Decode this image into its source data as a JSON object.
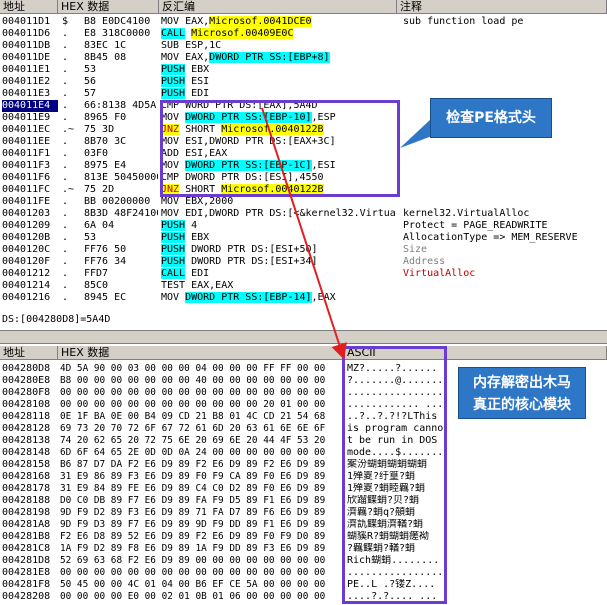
{
  "disasm": {
    "headers": {
      "addr": "地址",
      "hex": "HEX 数据",
      "asm": "反汇编",
      "comment": "注释"
    },
    "rows": [
      {
        "addr": "004011D1",
        "mark": "$",
        "hex": "B8 E0DC4100",
        "asm": "MOV EAX,Microsof.0041DCE0",
        "comment": "sub function load pe"
      },
      {
        "addr": "004011D6",
        "mark": ".",
        "hex": "E8 318C0000",
        "asm": "CALL Microsof.00409E0C",
        "comment": ""
      },
      {
        "addr": "004011DB",
        "mark": ".",
        "hex": "83EC 1C",
        "asm": "SUB ESP,1C",
        "comment": ""
      },
      {
        "addr": "004011DE",
        "mark": ".",
        "hex": "8B45 08",
        "asm": "MOV EAX,DWORD PTR SS:[EBP+8]",
        "comment": ""
      },
      {
        "addr": "004011E1",
        "mark": ".",
        "hex": "53",
        "asm": "PUSH EBX",
        "comment": ""
      },
      {
        "addr": "004011E2",
        "mark": ".",
        "hex": "56",
        "asm": "PUSH ESI",
        "comment": ""
      },
      {
        "addr": "004011E3",
        "mark": ".",
        "hex": "57",
        "asm": "PUSH EDI",
        "comment": ""
      },
      {
        "addr": "004011E4",
        "mark": ".",
        "hex": "66:8138 4D5A",
        "asm": "CMP WORD PTR DS:[EAX],5A4D",
        "comment": ""
      },
      {
        "addr": "004011E9",
        "mark": ".",
        "hex": "8965 F0",
        "asm": "MOV DWORD PTR SS:[EBP-10],ESP",
        "comment": ""
      },
      {
        "addr": "004011EC",
        "mark": ".~",
        "hex": "75 3D",
        "asm": "JNZ SHORT Microsof.0040122B",
        "comment": ""
      },
      {
        "addr": "004011EE",
        "mark": ".",
        "hex": "8B70 3C",
        "asm": "MOV ESI,DWORD PTR DS:[EAX+3C]",
        "comment": ""
      },
      {
        "addr": "004011F1",
        "mark": ".",
        "hex": "03F0",
        "asm": "ADD ESI,EAX",
        "comment": ""
      },
      {
        "addr": "004011F3",
        "mark": ".",
        "hex": "8975 E4",
        "asm": "MOV DWORD PTR SS:[EBP-1C],ESI",
        "comment": ""
      },
      {
        "addr": "004011F6",
        "mark": ".",
        "hex": "813E 50450000",
        "asm": "CMP DWORD PTR DS:[ESI],4550",
        "comment": ""
      },
      {
        "addr": "004011FC",
        "mark": ".~",
        "hex": "75 2D",
        "asm": "JNZ SHORT Microsof.0040122B",
        "comment": ""
      },
      {
        "addr": "004011FE",
        "mark": ".",
        "hex": "BB 00200000",
        "asm": "MOV EBX,2000",
        "comment": ""
      },
      {
        "addr": "00401203",
        "mark": ".",
        "hex": "8B3D 48F24100",
        "asm": "MOV EDI,DWORD PTR DS:[<&kernel32.Virtual",
        "comment": "kernel32.VirtualAlloc"
      },
      {
        "addr": "00401209",
        "mark": ".",
        "hex": "6A 04",
        "asm": "PUSH 4",
        "comment": "Protect = PAGE_READWRITE"
      },
      {
        "addr": "0040120B",
        "mark": ".",
        "hex": "53",
        "asm": "PUSH EBX",
        "comment": "AllocationType => MEM_RESERVE"
      },
      {
        "addr": "0040120C",
        "mark": ".",
        "hex": "FF76 50",
        "asm": "PUSH DWORD PTR DS:[ESI+50]",
        "comment": "Size"
      },
      {
        "addr": "0040120F",
        "mark": ".",
        "hex": "FF76 34",
        "asm": "PUSH DWORD PTR DS:[ESI+34]",
        "comment": "Address"
      },
      {
        "addr": "00401212",
        "mark": ".",
        "hex": "FFD7",
        "asm": "CALL EDI",
        "comment": "VirtualAlloc"
      },
      {
        "addr": "00401214",
        "mark": ".",
        "hex": "85C0",
        "asm": "TEST EAX,EAX",
        "comment": ""
      },
      {
        "addr": "00401216",
        "mark": ".",
        "hex": "8945 EC",
        "asm": "MOV DWORD PTR SS:[EBP-14],EAX",
        "comment": ""
      }
    ]
  },
  "status_text": "DS:[004280D8]=5A4D",
  "dump": {
    "headers": {
      "addr": "地址",
      "hex": "HEX 数据",
      "ascii": "ASCII"
    },
    "rows": [
      {
        "addr": "004280D8",
        "hex": "4D 5A 90 00 03 00 00 00 04 00 00 00 FF FF 00 00",
        "ascii": "MZ?.....?......"
      },
      {
        "addr": "004280E8",
        "hex": "B8 00 00 00 00 00 00 00 40 00 00 00 00 00 00 00",
        "ascii": "?.......@......."
      },
      {
        "addr": "004280F8",
        "hex": "00 00 00 00 00 00 00 00 00 00 00 00 00 00 00 00",
        "ascii": "................"
      },
      {
        "addr": "00428108",
        "hex": "00 00 00 00 00 00 00 00 00 00 00 00 20 01 00 00",
        "ascii": "............ ..."
      },
      {
        "addr": "00428118",
        "hex": "0E 1F BA 0E 00 B4 09 CD 21 B8 01 4C CD 21 54 68",
        "ascii": "..?..?.?!?LThis"
      },
      {
        "addr": "00428128",
        "hex": "69 73 20 70 72 6F 67 72 61 6D 20 63 61 6E 6E 6F",
        "ascii": "is program canno"
      },
      {
        "addr": "00428138",
        "hex": "74 20 62 65 20 72 75 6E 20 69 6E 20 44 4F 53 20",
        "ascii": "t be run in DOS"
      },
      {
        "addr": "00428148",
        "hex": "6D 6F 64 65 2E 0D 0D 0A 24 00 00 00 00 00 00 00",
        "ascii": "mode....$......."
      },
      {
        "addr": "00428158",
        "hex": "B6 87 D7 DA F2 E6 D9 89 F2 E6 D9 89 F2 E6 D9 89",
        "ascii": "案汾蝴蛸蝴蛸蝴蛸"
      },
      {
        "addr": "00428168",
        "hex": "31 E9 86 89 F3 E6 D9 89 F0 F9 CA 89 F0 E6 D9 89",
        "ascii": "1殚嵏?纡篁?蛸"
      },
      {
        "addr": "00428178",
        "hex": "31 E9 84 89 FE E6 D9 89 C4 C0 D2 89 F0 E6 D9 89",
        "ascii": "1殚嵏?蛸睦覊?蛸"
      },
      {
        "addr": "00428188",
        "hex": "D0 C0 DB 89 F7 E6 D9 89 FA F9 D5 89 F1 E6 D9 89",
        "ascii": "欣蹓鲽蛸?贝?蛸"
      },
      {
        "addr": "00428198",
        "hex": "9D F9 D2 89 F3 E6 D9 89 71 FA D7 89 F6 E6 D9 89",
        "ascii": "濟覊?蛸q?顤蛸"
      },
      {
        "addr": "004281A8",
        "hex": "9D F9 D3 89 F7 E6 D9 89 9D F9 DD 89 F1 E6 D9 89",
        "ascii": "濟訅鲽蛸濟輶?蛸"
      },
      {
        "addr": "004281B8",
        "hex": "F2 E6 D8 89 52 E6 D9 89 F2 E6 D9 89 F0 F9 D0 89",
        "ascii": "蝴貕R?蛸蝴蛸瘥袎"
      },
      {
        "addr": "004281C8",
        "hex": "1A F9 D2 89 F8 E6 D9 89 1A F9 DD 89 F3 E6 D9 89",
        "ascii": "?覊鲽蛸?輶?蛸"
      },
      {
        "addr": "004281D8",
        "hex": "52 69 63 68 F2 E6 D9 89 00 00 00 00 00 00 00 00",
        "ascii": "Rich蝴蛸........"
      },
      {
        "addr": "004281E8",
        "hex": "00 00 00 00 00 00 00 00 00 00 00 00 00 00 00 00",
        "ascii": "................"
      },
      {
        "addr": "004281F8",
        "hex": "50 45 00 00 4C 01 04 00 B6 EF CE 5A 00 00 00 00",
        "ascii": "PE..L .?镂Z...."
      },
      {
        "addr": "00428208",
        "hex": "00 00 00 00 E0 00 02 01 0B 01 06 00 00 00 00 00",
        "ascii": "....?.?.... ..."
      }
    ]
  },
  "callouts": {
    "pe_check": "检查PE格式头",
    "trojan": "内存解密出木马\n真正的核心模块"
  },
  "colors": {
    "annotation_box": "#6a3ccf",
    "callout_bg": "#2e77c6",
    "arrow": "#e02020"
  }
}
